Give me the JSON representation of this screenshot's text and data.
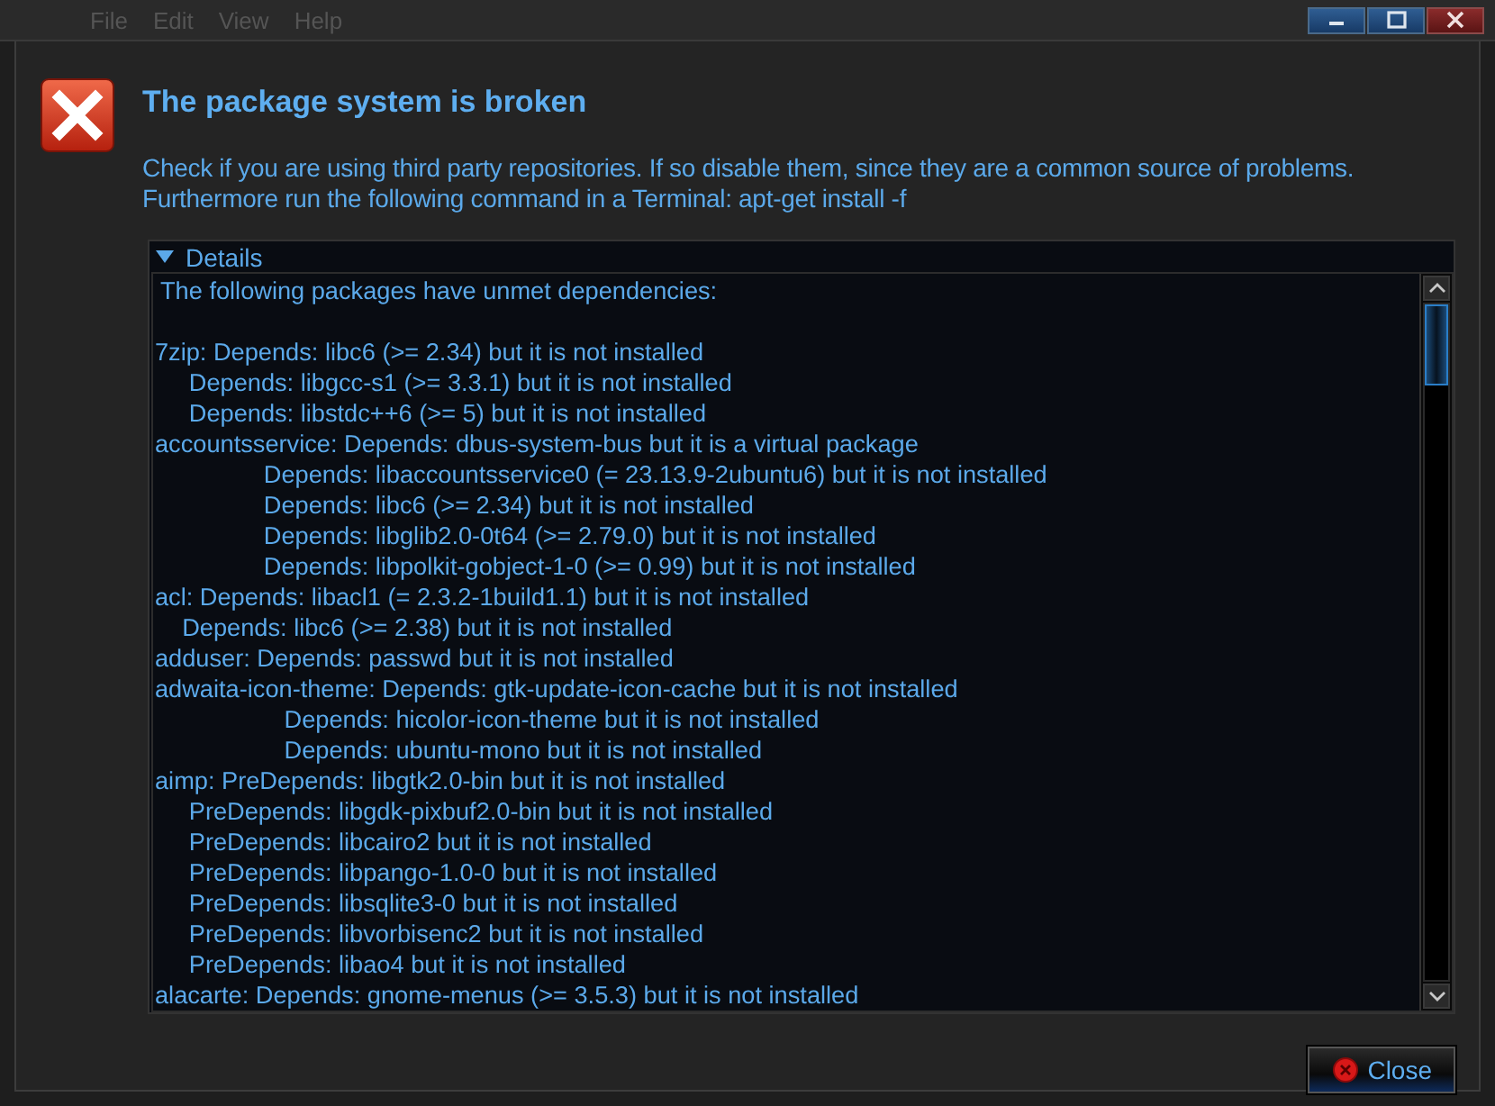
{
  "window": {
    "menu": [
      "File",
      "Edit",
      "View",
      "Help"
    ]
  },
  "dialog": {
    "title": "The package system is broken",
    "message": [
      "Check if you are using third party repositories. If so disable them, since they are a common source of problems.",
      "Furthermore run the following command in a Terminal: apt-get install -f"
    ],
    "details": {
      "label": "Details",
      "expanded": true,
      "intro": "The following packages have unmet dependencies:",
      "lines": [
        "7zip: Depends: libc6 (>= 2.34) but it is not installed",
        "     Depends: libgcc-s1 (>= 3.3.1) but it is not installed",
        "     Depends: libstdc++6 (>= 5) but it is not installed",
        "accountsservice: Depends: dbus-system-bus but it is a virtual package",
        "                Depends: libaccountsservice0 (= 23.13.9-2ubuntu6) but it is not installed",
        "                Depends: libc6 (>= 2.34) but it is not installed",
        "                Depends: libglib2.0-0t64 (>= 2.79.0) but it is not installed",
        "                Depends: libpolkit-gobject-1-0 (>= 0.99) but it is not installed",
        "acl: Depends: libacl1 (= 2.3.2-1build1.1) but it is not installed",
        "    Depends: libc6 (>= 2.38) but it is not installed",
        "adduser: Depends: passwd but it is not installed",
        "adwaita-icon-theme: Depends: gtk-update-icon-cache but it is not installed",
        "                   Depends: hicolor-icon-theme but it is not installed",
        "                   Depends: ubuntu-mono but it is not installed",
        "aimp: PreDepends: libgtk2.0-bin but it is not installed",
        "     PreDepends: libgdk-pixbuf2.0-bin but it is not installed",
        "     PreDepends: libcairo2 but it is not installed",
        "     PreDepends: libpango-1.0-0 but it is not installed",
        "     PreDepends: libsqlite3-0 but it is not installed",
        "     PreDepends: libvorbisenc2 but it is not installed",
        "     PreDepends: libao4 but it is not installed",
        "alacarte: Depends: gnome-menus (>= 3.5.3) but it is not installed"
      ]
    },
    "buttons": [
      {
        "label": "Close"
      }
    ]
  }
}
